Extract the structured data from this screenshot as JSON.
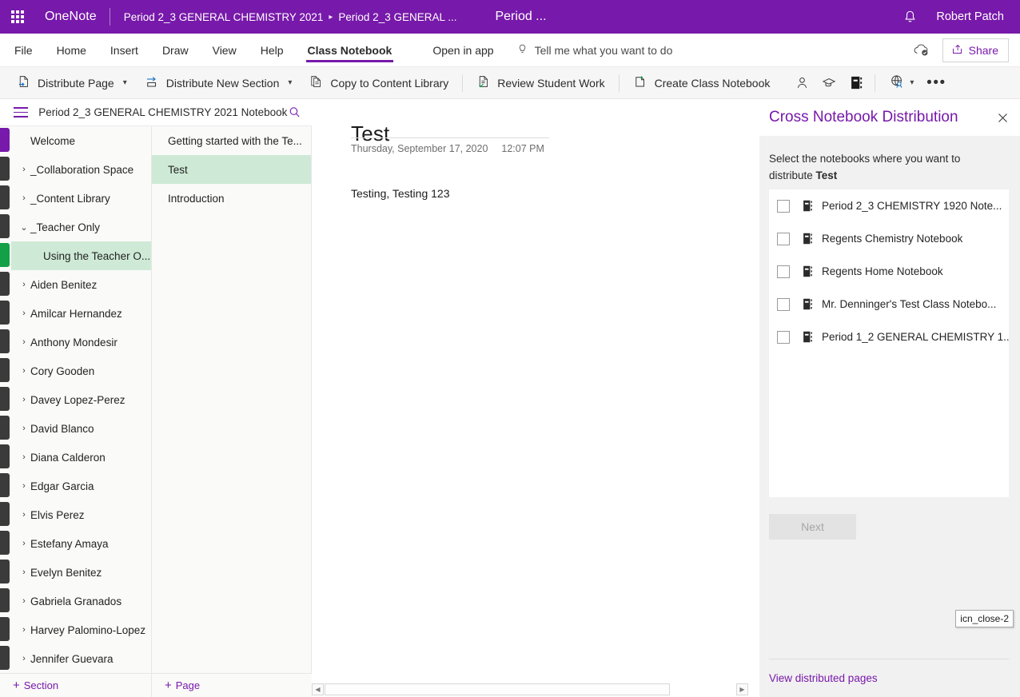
{
  "topbar": {
    "waffle_icon": "app-launcher-icon",
    "brand": "OneNote",
    "breadcrumb_root": "Period 2_3 GENERAL CHEMISTRY 2021",
    "breadcrumb_sep": "▸",
    "breadcrumb_current": "Period 2_3 GENERAL ...",
    "doc_title": "Period ...",
    "bell_icon": "notifications-bell-icon",
    "user": "Robert Patch",
    "accent": "#7719aa"
  },
  "ribbon": {
    "tabs": [
      {
        "label": "File",
        "active": false
      },
      {
        "label": "Home",
        "active": false
      },
      {
        "label": "Insert",
        "active": false
      },
      {
        "label": "Draw",
        "active": false
      },
      {
        "label": "View",
        "active": false
      },
      {
        "label": "Help",
        "active": false
      },
      {
        "label": "Class Notebook",
        "active": true
      }
    ],
    "open_in_app": "Open in app",
    "tellme_icon": "lightbulb-icon",
    "tellme": "Tell me what you want to do",
    "cloud_icon": "cloud-saved-icon",
    "share_icon": "share-icon",
    "share": "Share"
  },
  "toolbar": {
    "items": [
      {
        "label": "Distribute Page",
        "icon": "distribute-page-icon",
        "caret": true
      },
      {
        "label": "Distribute New Section",
        "icon": "distribute-section-icon",
        "caret": true
      },
      {
        "label": "Copy to Content Library",
        "icon": "copy-document-icon",
        "caret": false
      },
      {
        "label": "Review Student Work",
        "icon": "review-check-icon",
        "caret": false
      },
      {
        "label": "Create Class Notebook",
        "icon": "create-notebook-icon",
        "caret": false
      }
    ],
    "icon_buttons": [
      "person-icon",
      "graduation-cap-icon",
      "notebook-icon"
    ],
    "globe_icon": "globe-person-icon",
    "globe_caret": "⌄",
    "overflow": "•••"
  },
  "notebook_header": {
    "hamburger_icon": "hamburger-menu-icon",
    "title": "Period 2_3 GENERAL CHEMISTRY 2021 Notebook",
    "search_icon": "search-icon"
  },
  "sections": [
    {
      "label": "Welcome",
      "chevron": "",
      "indent": "none",
      "selected": false,
      "rail_color": "#7719aa"
    },
    {
      "label": "_Collaboration Space",
      "chevron": "›",
      "indent": "none",
      "selected": false,
      "rail_color": "#3b3b3b"
    },
    {
      "label": "_Content Library",
      "chevron": "›",
      "indent": "none",
      "selected": false,
      "rail_color": "#3b3b3b"
    },
    {
      "label": "_Teacher Only",
      "chevron": "⌄",
      "indent": "none",
      "selected": false,
      "rail_color": "#3b3b3b"
    },
    {
      "label": "Using the Teacher O...",
      "chevron": "",
      "indent": "child",
      "selected": true,
      "rail_color": "#13a046"
    },
    {
      "label": "Aiden Benitez",
      "chevron": "›",
      "indent": "none",
      "selected": false,
      "rail_color": "#3b3b3b"
    },
    {
      "label": "Amilcar Hernandez",
      "chevron": "›",
      "indent": "none",
      "selected": false,
      "rail_color": "#3b3b3b"
    },
    {
      "label": "Anthony Mondesir",
      "chevron": "›",
      "indent": "none",
      "selected": false,
      "rail_color": "#3b3b3b"
    },
    {
      "label": "Cory Gooden",
      "chevron": "›",
      "indent": "none",
      "selected": false,
      "rail_color": "#3b3b3b"
    },
    {
      "label": "Davey Lopez-Perez",
      "chevron": "›",
      "indent": "none",
      "selected": false,
      "rail_color": "#3b3b3b"
    },
    {
      "label": "David Blanco",
      "chevron": "›",
      "indent": "none",
      "selected": false,
      "rail_color": "#3b3b3b"
    },
    {
      "label": "Diana Calderon",
      "chevron": "›",
      "indent": "none",
      "selected": false,
      "rail_color": "#3b3b3b"
    },
    {
      "label": "Edgar Garcia",
      "chevron": "›",
      "indent": "none",
      "selected": false,
      "rail_color": "#3b3b3b"
    },
    {
      "label": "Elvis Perez",
      "chevron": "›",
      "indent": "none",
      "selected": false,
      "rail_color": "#3b3b3b"
    },
    {
      "label": "Estefany Amaya",
      "chevron": "›",
      "indent": "none",
      "selected": false,
      "rail_color": "#3b3b3b"
    },
    {
      "label": "Evelyn Benitez",
      "chevron": "›",
      "indent": "none",
      "selected": false,
      "rail_color": "#3b3b3b"
    },
    {
      "label": "Gabriela Granados",
      "chevron": "›",
      "indent": "none",
      "selected": false,
      "rail_color": "#3b3b3b"
    },
    {
      "label": "Harvey Palomino-Lopez",
      "chevron": "›",
      "indent": "none",
      "selected": false,
      "rail_color": "#3b3b3b"
    },
    {
      "label": "Jennifer Guevara",
      "chevron": "›",
      "indent": "none",
      "selected": false,
      "rail_color": "#3b3b3b"
    }
  ],
  "pages": [
    {
      "label": "Getting started with the Te...",
      "selected": false
    },
    {
      "label": "Test",
      "selected": true
    },
    {
      "label": "Introduction",
      "selected": false
    }
  ],
  "add_buttons": {
    "section": "Section",
    "page": "Page",
    "plus": "+"
  },
  "canvas": {
    "page_title": "Test",
    "date": "Thursday, September 17, 2020",
    "time": "12:07 PM",
    "body": "Testing, Testing 123"
  },
  "scrollbar": {
    "left_arrow": "◀",
    "right_arrow": "▶"
  },
  "panel": {
    "title": "Cross Notebook Distribution",
    "close_icon": "close-icon",
    "desc_prefix": "Select the notebooks where you want to distribute ",
    "desc_bold": "Test",
    "notebooks": [
      {
        "label": "Period 2_3 CHEMISTRY 1920 Note...",
        "checked": false,
        "icon": "notebook-icon"
      },
      {
        "label": "Regents Chemistry Notebook",
        "checked": false,
        "icon": "notebook-icon"
      },
      {
        "label": "Regents Home Notebook",
        "checked": false,
        "icon": "notebook-icon"
      },
      {
        "label": "Mr. Denninger's Test Class Notebo...",
        "checked": false,
        "icon": "notebook-icon"
      },
      {
        "label": "Period 1_2 GENERAL CHEMISTRY 1...",
        "checked": false,
        "icon": "notebook-icon"
      }
    ],
    "next_label": "Next",
    "tooltip": "icn_close-2",
    "footer_link": "View distributed pages"
  }
}
